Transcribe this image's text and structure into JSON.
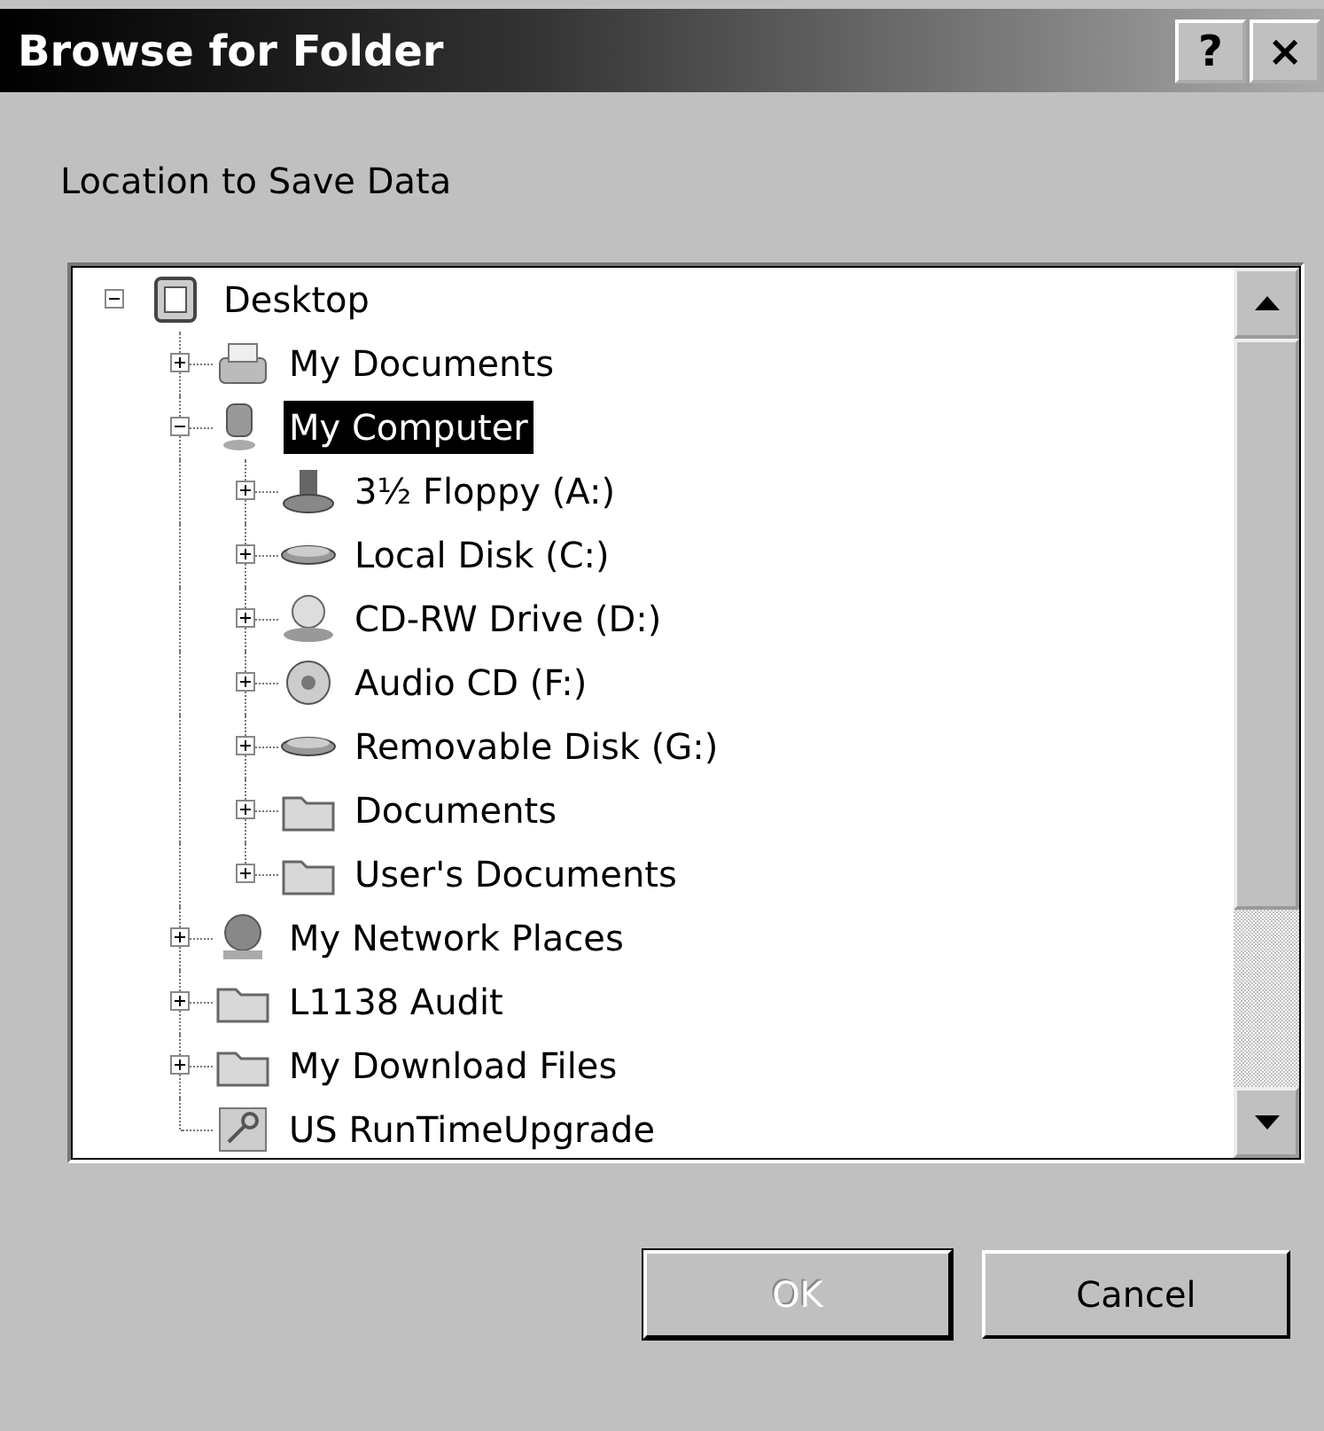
{
  "window": {
    "title": "Browse for Folder",
    "title_buttons": [
      "?",
      "×"
    ]
  },
  "prompt": "Location to Save Data",
  "tree": [
    {
      "label": "Desktop",
      "kind": "desktop",
      "expanded": true,
      "selected": false,
      "children": [
        {
          "label": "My Documents",
          "kind": "documents",
          "expanded": false,
          "selected": false
        },
        {
          "label": "My Computer",
          "kind": "computer",
          "expanded": true,
          "selected": true,
          "children": [
            {
              "label": "3½ Floppy (A:)",
              "kind": "floppy",
              "expanded": false,
              "selected": false
            },
            {
              "label": "Local Disk (C:)",
              "kind": "disk",
              "expanded": false,
              "selected": false
            },
            {
              "label": "CD-RW Drive (D:)",
              "kind": "cdrom",
              "expanded": false,
              "selected": false
            },
            {
              "label": "Audio CD (F:)",
              "kind": "audio-cd",
              "expanded": false,
              "selected": false
            },
            {
              "label": "Removable Disk (G:)",
              "kind": "removable",
              "expanded": false,
              "selected": false
            },
            {
              "label": "Documents",
              "kind": "folder",
              "expanded": false,
              "selected": false
            },
            {
              "label": "User's Documents",
              "kind": "folder",
              "expanded": false,
              "selected": false
            }
          ]
        },
        {
          "label": "My Network Places",
          "kind": "network",
          "expanded": false,
          "selected": false
        },
        {
          "label": "L1138 Audit",
          "kind": "folder",
          "expanded": false,
          "selected": false
        },
        {
          "label": "My Download Files",
          "kind": "folder",
          "expanded": false,
          "selected": false
        },
        {
          "label": "US RunTimeUpgrade",
          "kind": "shortcut",
          "selected": false
        }
      ]
    }
  ],
  "buttons": [
    {
      "label": "OK",
      "disabled": true
    },
    {
      "label": "Cancel",
      "disabled": false
    }
  ]
}
